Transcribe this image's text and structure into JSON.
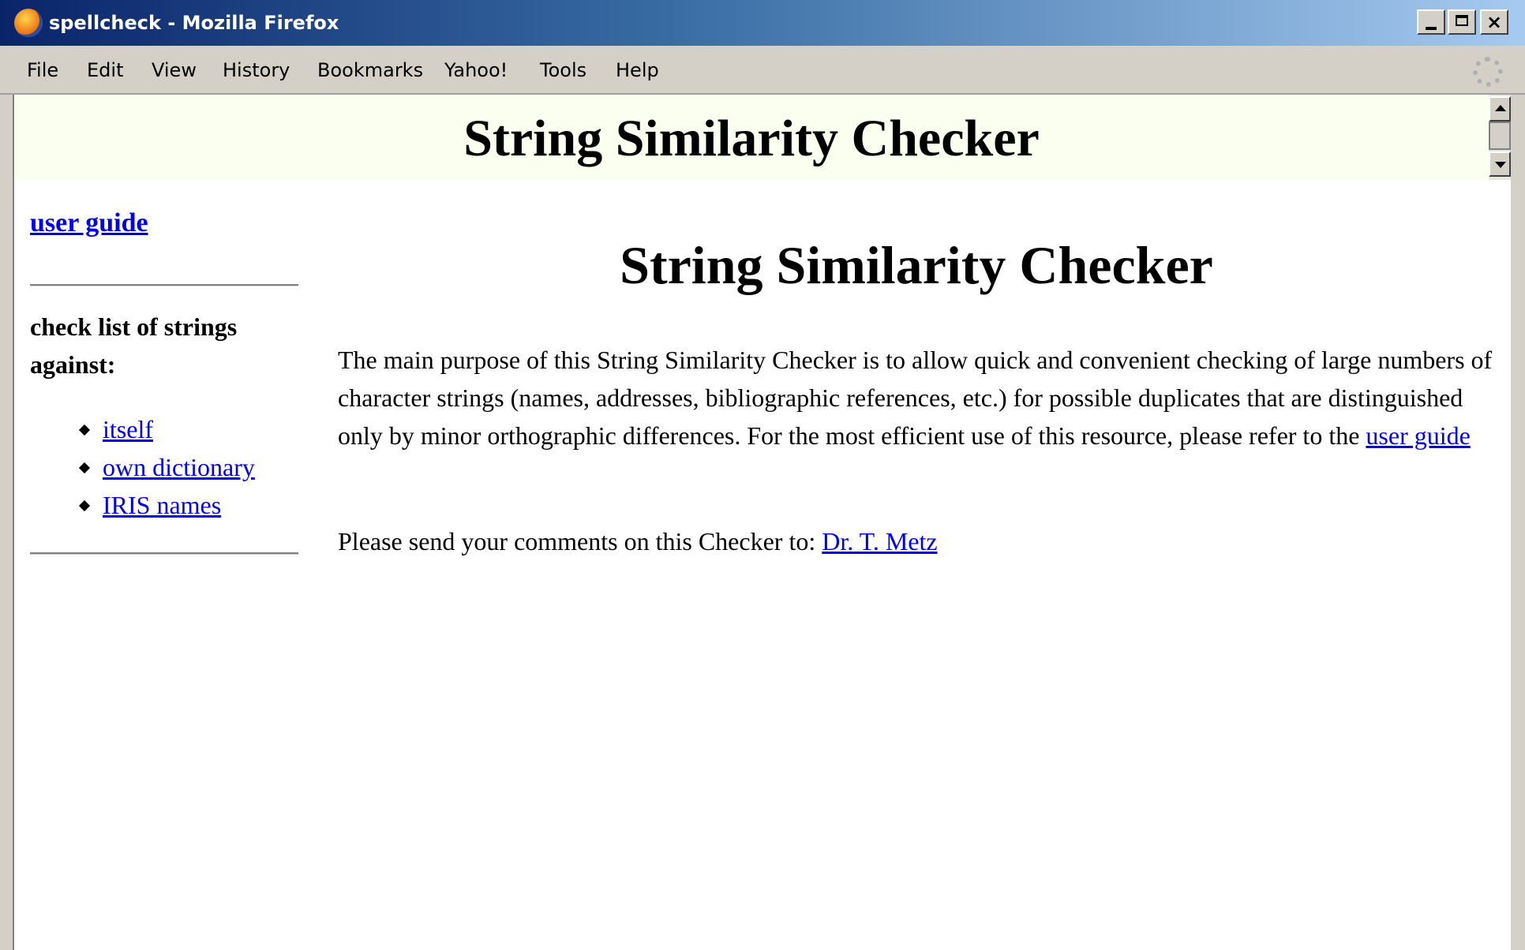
{
  "window": {
    "title": "spellcheck - Mozilla Firefox",
    "icon": "firefox-icon",
    "controls": {
      "minimize": "minimize-icon",
      "maximize": "maximize-icon",
      "close": "×"
    }
  },
  "menubar": {
    "items": [
      "File",
      "Edit",
      "View",
      "History",
      "Bookmarks",
      "Yahoo!",
      "Tools",
      "Help"
    ]
  },
  "header": {
    "title": "String Similarity Checker",
    "background": "#fafff0"
  },
  "sidebar": {
    "guide_link": "user guide",
    "heading": "check list of strings against:",
    "links": [
      "itself",
      "own dictionary",
      "IRIS names"
    ]
  },
  "main": {
    "title": "String Similarity Checker",
    "intro": {
      "text": "The main purpose of this String Similarity Checker is to allow quick and convenient checking of large numbers of character strings (names, addresses, bibliographic references, etc.) for possible duplicates that are distinguished only by minor orthographic differences. For the most efficient use of this resource, please refer to the",
      "link": "user guide"
    },
    "contact": {
      "text": "Please send your comments on this Checker to:",
      "link": "Dr. T. Metz"
    }
  },
  "colors": {
    "link": "#0000ee",
    "titlebar_start": "#0a246a",
    "titlebar_end": "#a6caf0",
    "chrome": "#d4d0c8"
  }
}
